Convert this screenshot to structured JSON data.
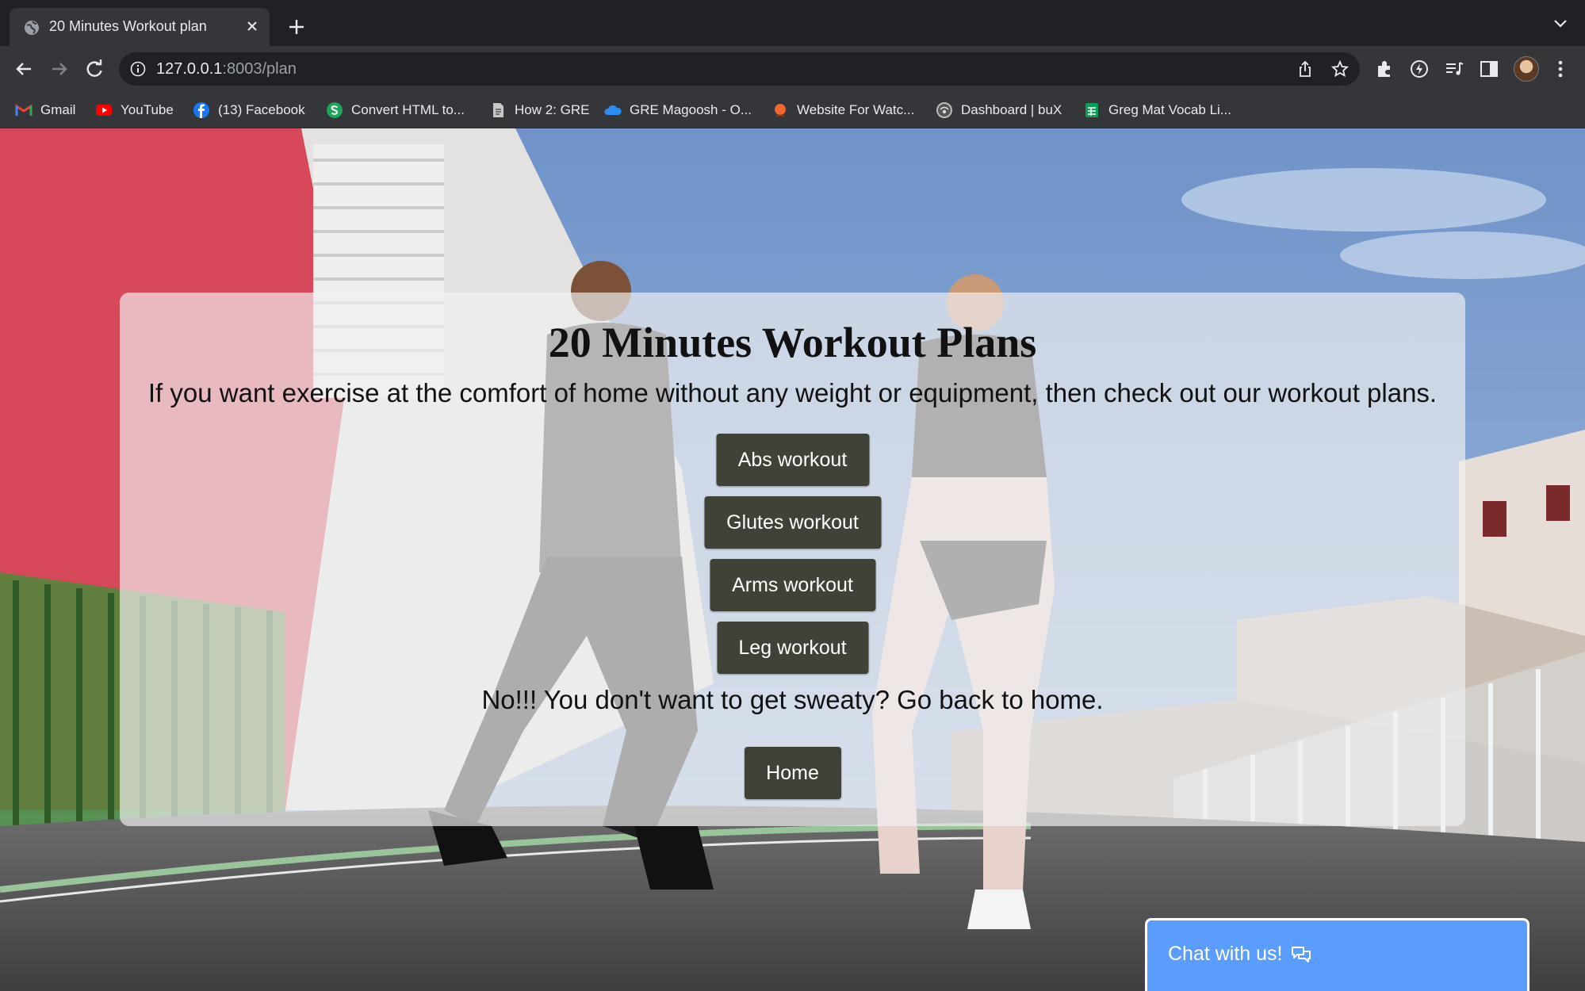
{
  "browser": {
    "tab_title": "20 Minutes Workout plan",
    "url_host": "127.0.0.1",
    "url_path": ":8003/plan",
    "bookmarks": [
      {
        "label": "Gmail",
        "icon": "gmail-icon"
      },
      {
        "label": "YouTube",
        "icon": "youtube-icon"
      },
      {
        "label": "(13) Facebook",
        "icon": "facebook-icon"
      },
      {
        "label": "Convert HTML to...",
        "icon": "convert-icon"
      },
      {
        "label": "How 2: GRE",
        "icon": "document-icon"
      },
      {
        "label": "GRE Magoosh - O...",
        "icon": "cloud-icon"
      },
      {
        "label": "Website For Watc...",
        "icon": "website-icon"
      },
      {
        "label": "Dashboard | buX",
        "icon": "dashboard-icon"
      },
      {
        "label": "Greg Mat Vocab Li...",
        "icon": "sheets-icon"
      }
    ]
  },
  "page": {
    "heading": "20 Minutes Workout Plans",
    "lead": "If you want exercise at the comfort of home without any weight or equipment, then check out our workout plans.",
    "buttons": {
      "abs": "Abs workout",
      "glutes": "Glutes workout",
      "arms": "Arms workout",
      "leg": "Leg workout"
    },
    "back_text": "No!!! You don't want to get sweaty? Go back to home.",
    "home_button": "Home"
  },
  "chat": {
    "label": "Chat with us!",
    "icon": "chat-bubbles-icon"
  },
  "colors": {
    "chrome_dark": "#202124",
    "chrome_toolbar": "#35363a",
    "button_bg": "#3f4236",
    "chat_bg": "#5b9cff"
  }
}
